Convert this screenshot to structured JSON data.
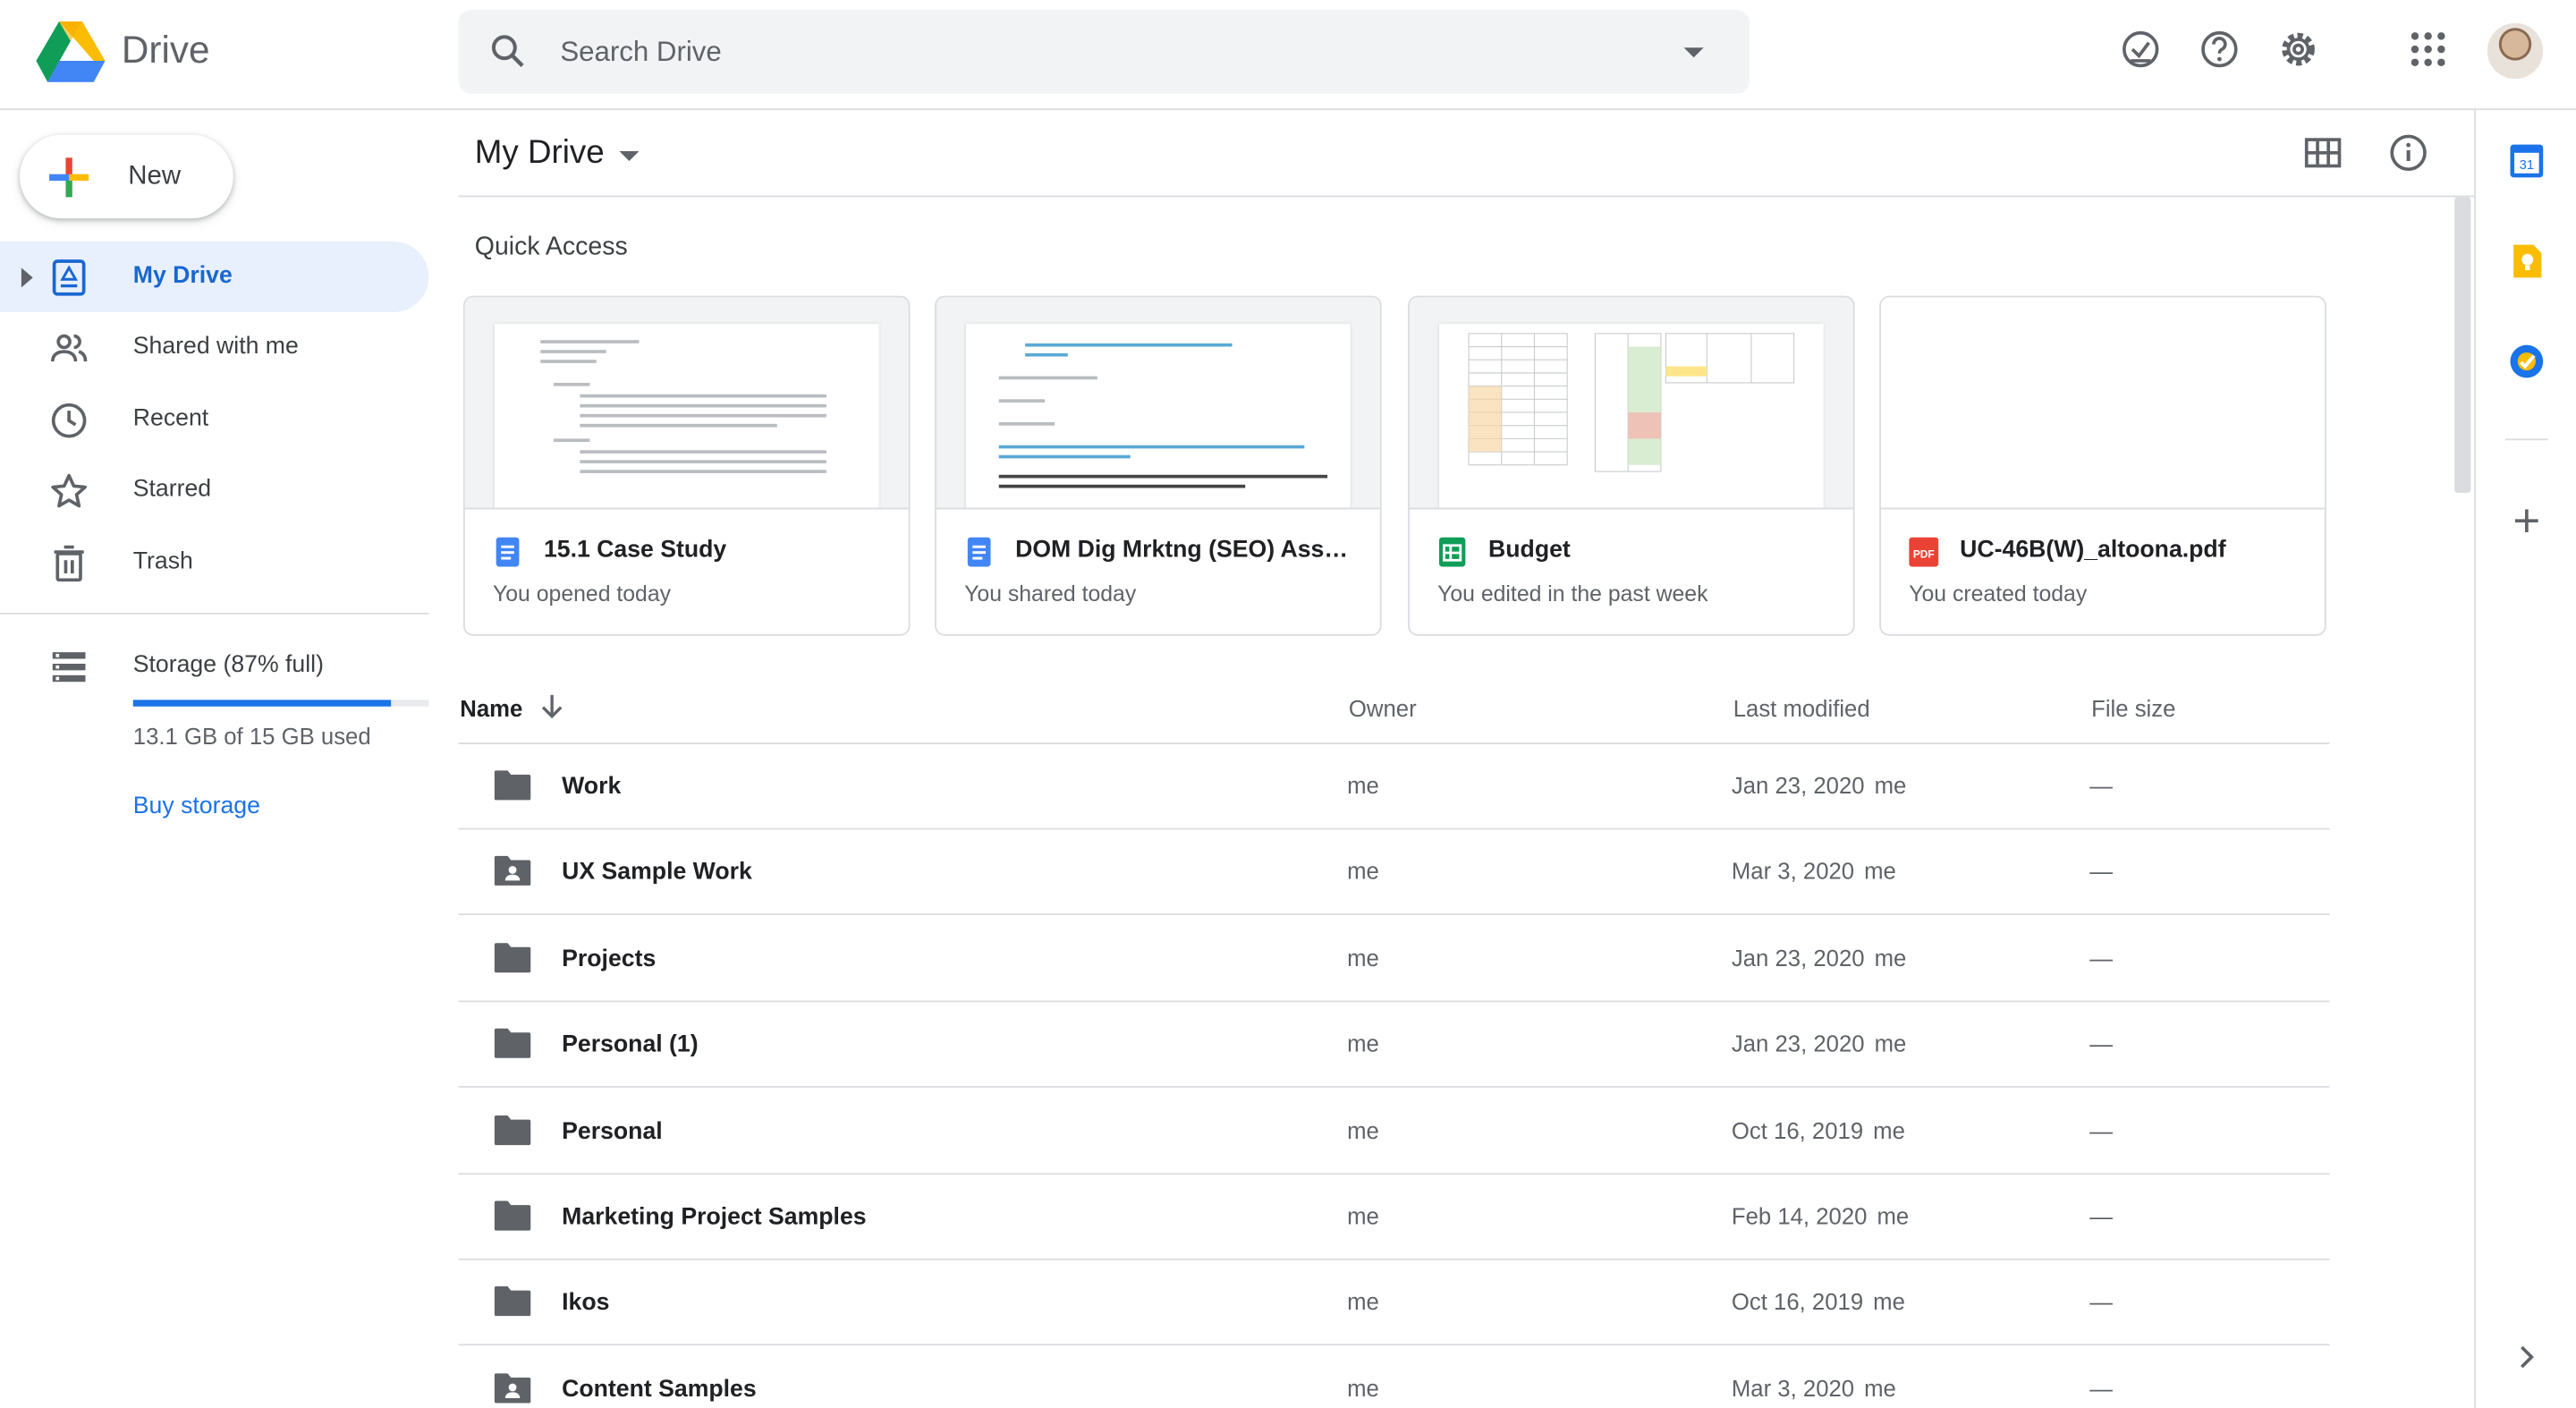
{
  "header": {
    "app_name": "Drive",
    "search_placeholder": "Search Drive",
    "icons": [
      "drive-logo-icon",
      "search-icon",
      "search-options-icon",
      "ready-for-offline-icon",
      "help-icon",
      "settings-icon",
      "apps-grid-icon",
      "account-avatar"
    ]
  },
  "sidebar": {
    "new_label": "New",
    "items": [
      {
        "label": "My Drive",
        "icon": "my-drive-icon",
        "active": true
      },
      {
        "label": "Shared with me",
        "icon": "shared-icon"
      },
      {
        "label": "Recent",
        "icon": "clock-icon"
      },
      {
        "label": "Starred",
        "icon": "star-icon"
      },
      {
        "label": "Trash",
        "icon": "trash-icon"
      }
    ],
    "storage": {
      "label": "Storage (87% full)",
      "used_text": "13.1 GB of 15 GB used",
      "fraction_used": 0.87,
      "buy_label": "Buy storage"
    }
  },
  "main": {
    "title": "My Drive",
    "quick_access_label": "Quick Access",
    "quick_access": [
      {
        "name": "15.1 Case Study",
        "subtitle": "You opened today",
        "type": "doc"
      },
      {
        "name": "DOM Dig Mrktng (SEO) Associ...",
        "subtitle": "You shared today",
        "type": "doc"
      },
      {
        "name": "Budget",
        "subtitle": "You edited in the past week",
        "type": "sheet"
      },
      {
        "name": "UC-46B(W)_altoona.pdf",
        "subtitle": "You created today",
        "type": "pdf"
      }
    ],
    "columns": {
      "name": "Name",
      "owner": "Owner",
      "modified": "Last modified",
      "size": "File size"
    },
    "files": [
      {
        "name": "Work",
        "owner": "me",
        "modified": "Jan 23, 2020",
        "modified_by": "me",
        "size": "—",
        "shared": false
      },
      {
        "name": "UX Sample Work",
        "owner": "me",
        "modified": "Mar 3, 2020",
        "modified_by": "me",
        "size": "—",
        "shared": true
      },
      {
        "name": "Projects",
        "owner": "me",
        "modified": "Jan 23, 2020",
        "modified_by": "me",
        "size": "—",
        "shared": false
      },
      {
        "name": "Personal (1)",
        "owner": "me",
        "modified": "Jan 23, 2020",
        "modified_by": "me",
        "size": "—",
        "shared": false
      },
      {
        "name": "Personal",
        "owner": "me",
        "modified": "Oct 16, 2019",
        "modified_by": "me",
        "size": "—",
        "shared": false
      },
      {
        "name": "Marketing Project Samples",
        "owner": "me",
        "modified": "Feb 14, 2020",
        "modified_by": "me",
        "size": "—",
        "shared": false
      },
      {
        "name": "Ikos",
        "owner": "me",
        "modified": "Oct 16, 2019",
        "modified_by": "me",
        "size": "—",
        "shared": false
      },
      {
        "name": "Content Samples",
        "owner": "me",
        "modified": "Mar 3, 2020",
        "modified_by": "me",
        "size": "—",
        "shared": true
      }
    ]
  },
  "right_rail": {
    "calendar_day": "31",
    "icons": [
      "calendar-icon",
      "keep-icon",
      "tasks-icon",
      "add-addon-icon",
      "expand-panel-icon"
    ]
  },
  "colors": {
    "accent": "#1a73e8",
    "active_bg": "#e8f0fe",
    "divider": "#dadce0",
    "secondary_text": "#5f6368"
  }
}
